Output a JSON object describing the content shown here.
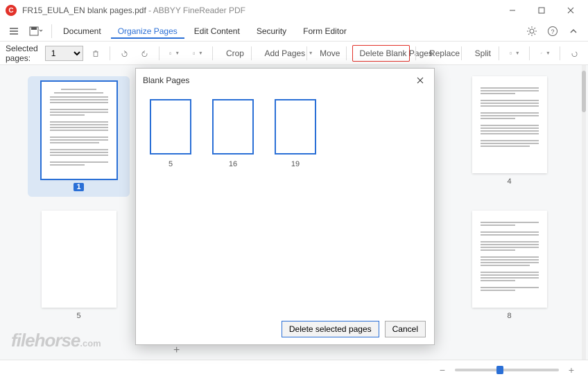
{
  "window": {
    "filename": "FR15_EULA_EN blank pages.pdf",
    "appname": "ABBYY FineReader PDF"
  },
  "menu": {
    "items": [
      "Document",
      "Organize Pages",
      "Edit Content",
      "Security",
      "Form Editor"
    ],
    "active_index": 1
  },
  "toolbar": {
    "selected_pages_label": "Selected pages:",
    "selected_value": "1",
    "crop": "Crop",
    "add_pages": "Add Pages",
    "move": "Move",
    "delete_blank": "Delete Blank Pages",
    "replace": "Replace",
    "split": "Split"
  },
  "thumbnails": [
    {
      "num": "1",
      "selected": true,
      "blank": false
    },
    {
      "num": "4",
      "selected": false,
      "blank": false
    },
    {
      "num": "5",
      "selected": false,
      "blank": true
    },
    {
      "num": "8",
      "selected": false,
      "blank": false
    }
  ],
  "dialog": {
    "title": "Blank Pages",
    "pages": [
      "5",
      "16",
      "19"
    ],
    "primary": "Delete selected pages",
    "cancel": "Cancel"
  },
  "watermark": {
    "brand": "filehorse",
    "suffix": ".com"
  }
}
